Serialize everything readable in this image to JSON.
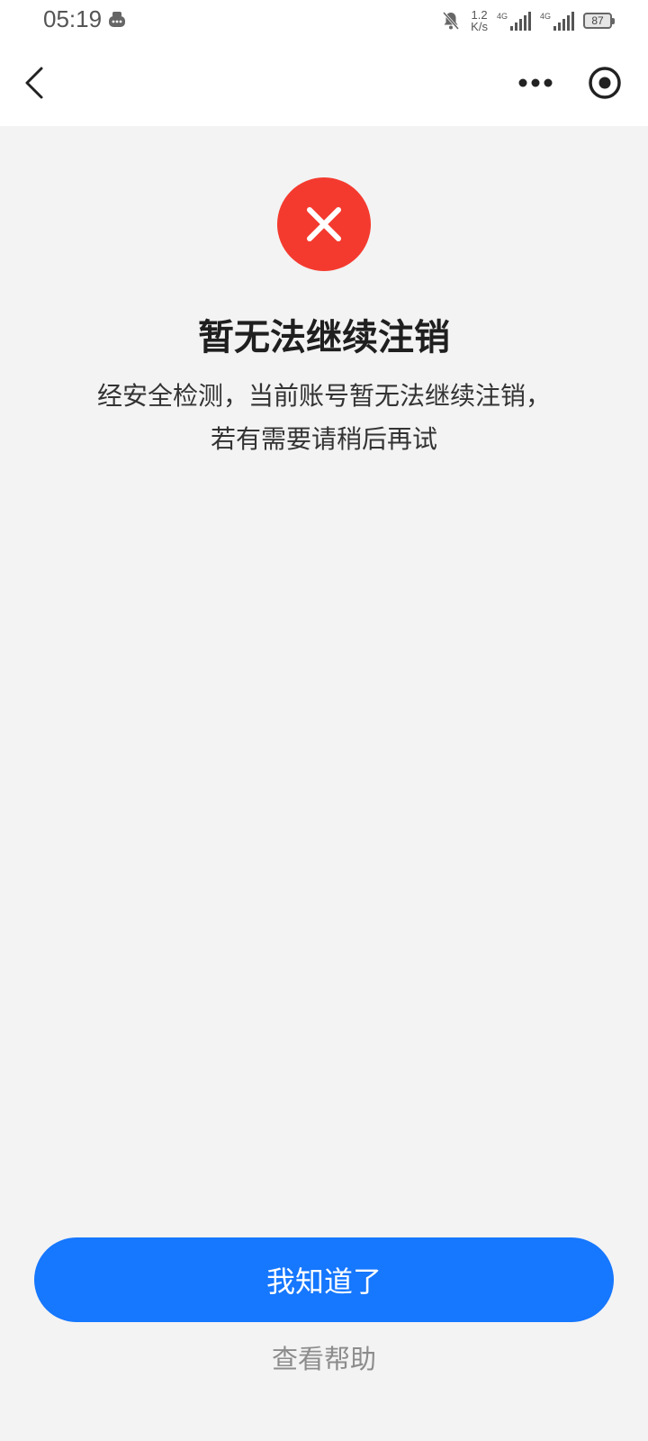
{
  "status_bar": {
    "time": "05:19",
    "net_speed_value": "1.2",
    "net_speed_unit": "K/s",
    "signal1_label": "4G",
    "signal2_label": "4G",
    "battery": "87"
  },
  "nav": {
    "back_icon": "chevron-left-icon",
    "more_icon": "more-dots-icon",
    "target_icon": "target-icon"
  },
  "main": {
    "status_icon": "close-icon",
    "status_color": "#f43a2f",
    "title": "暂无法继续注销",
    "desc_line1": "经安全检测，当前账号暂无法继续注销，",
    "desc_line2": "若有需要请稍后再试"
  },
  "footer": {
    "confirm_label": "我知道了",
    "help_label": "查看帮助",
    "accent": "#1677ff"
  }
}
